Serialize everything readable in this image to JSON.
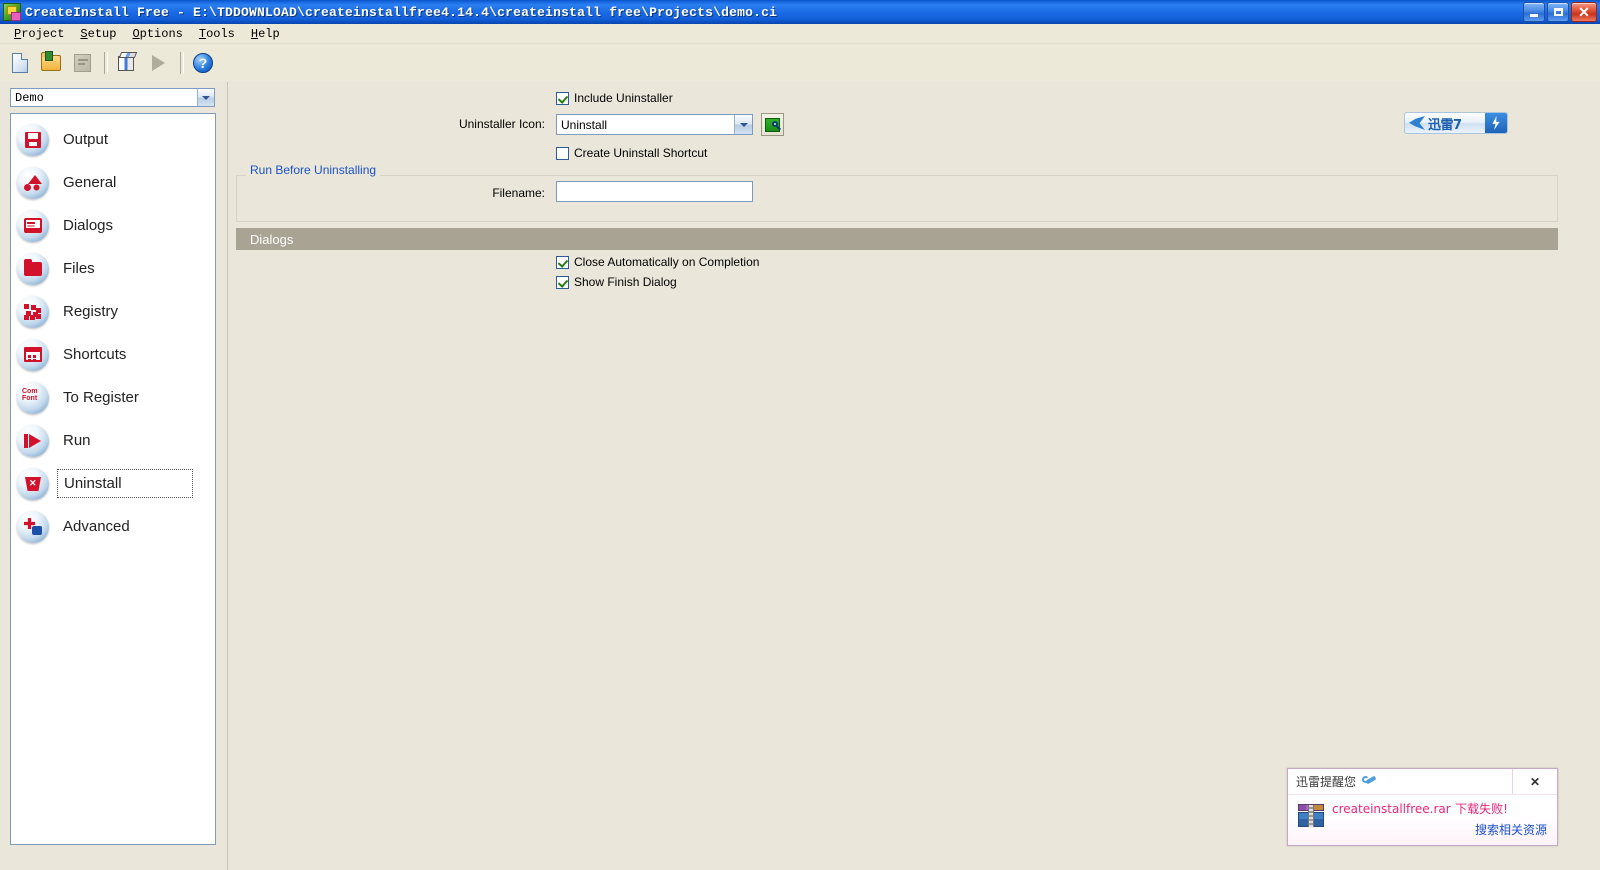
{
  "window": {
    "title": "CreateInstall Free - E:\\TDDOWNLOAD\\createinstallfree4.14.4\\createinstall free\\Projects\\demo.ci",
    "icon": "app-icon",
    "controls": {
      "minimize": "minimize",
      "restore": "restore",
      "close": "close"
    }
  },
  "menubar": {
    "items": [
      {
        "label": "Project",
        "mnemonic": "P"
      },
      {
        "label": "Setup",
        "mnemonic": "S"
      },
      {
        "label": "Options",
        "mnemonic": "O"
      },
      {
        "label": "Tools",
        "mnemonic": "T"
      },
      {
        "label": "Help",
        "mnemonic": "H"
      }
    ]
  },
  "toolbar": {
    "buttons": [
      {
        "name": "new-project-icon",
        "enabled": true
      },
      {
        "name": "open-project-icon",
        "enabled": true
      },
      {
        "name": "save-project-icon",
        "enabled": false
      },
      {
        "name": "build-package-icon",
        "enabled": true
      },
      {
        "name": "run-icon",
        "enabled": false
      },
      {
        "name": "help-icon",
        "enabled": true,
        "glyph": "?"
      }
    ]
  },
  "project_selector": {
    "value": "Demo",
    "arrow": "chevron-down-icon"
  },
  "sidebar": {
    "items": [
      {
        "label": "Output",
        "icon": "floppy-disk-icon",
        "selected": false
      },
      {
        "label": "General",
        "icon": "shapes-icon",
        "selected": false
      },
      {
        "label": "Dialogs",
        "icon": "monitor-icon",
        "selected": false
      },
      {
        "label": "Files",
        "icon": "folder-icon",
        "selected": false
      },
      {
        "label": "Registry",
        "icon": "registry-icon",
        "selected": false
      },
      {
        "label": "Shortcuts",
        "icon": "shortcuts-icon",
        "selected": false
      },
      {
        "label": "To Register",
        "icon": "com-font-icon",
        "selected": false,
        "icon_text_top": "Com",
        "icon_text_bottom": "Font"
      },
      {
        "label": "Run",
        "icon": "play-icon",
        "selected": false
      },
      {
        "label": "Uninstall",
        "icon": "uninstall-icon",
        "selected": true
      },
      {
        "label": "Advanced",
        "icon": "advanced-icon",
        "selected": false
      }
    ]
  },
  "main": {
    "include_uninstaller": {
      "label": "Include Uninstaller",
      "checked": true
    },
    "uninstaller_icon": {
      "label": "Uninstaller Icon:",
      "value": "Uninstall",
      "browse_icon": "browse-preview-icon"
    },
    "create_uninstall_shortcut": {
      "label": "Create Uninstall Shortcut",
      "checked": false
    },
    "run_before_group": {
      "title": "Run Before Uninstalling",
      "filename_label": "Filename:",
      "filename_value": "",
      "filename_placeholder": ""
    },
    "dialogs_section": {
      "title": "Dialogs",
      "options": [
        {
          "label": "Close Automatically on Completion",
          "checked": true
        },
        {
          "label": "Show Finish Dialog",
          "checked": true
        }
      ]
    }
  },
  "xunlei_badge": {
    "text": "迅雷7",
    "bird_icon": "xunlei-bird-icon",
    "bolt_icon": "lightning-bolt-icon"
  },
  "notification": {
    "header": "迅雷提醒您",
    "header_icon": "wrench-icon",
    "file_icon": "rar-archive-icon",
    "filename": "createinstallfree.rar",
    "status": "下载失败!",
    "link": "搜索相关资源",
    "close_label": "✕"
  },
  "colors": {
    "titlebar_blue": "#1a6be6",
    "window_bg": "#EAE7DA",
    "menubar_bg": "#ECE9D8",
    "section_bar": "#A8A393",
    "group_label_blue": "#1B52C4",
    "checkbox_border": "#2a5b9b",
    "check_green": "#2a7a12",
    "link_blue": "#1B4FC9",
    "alert_pink": "#E8257A",
    "icon_red": "#d2122a"
  }
}
